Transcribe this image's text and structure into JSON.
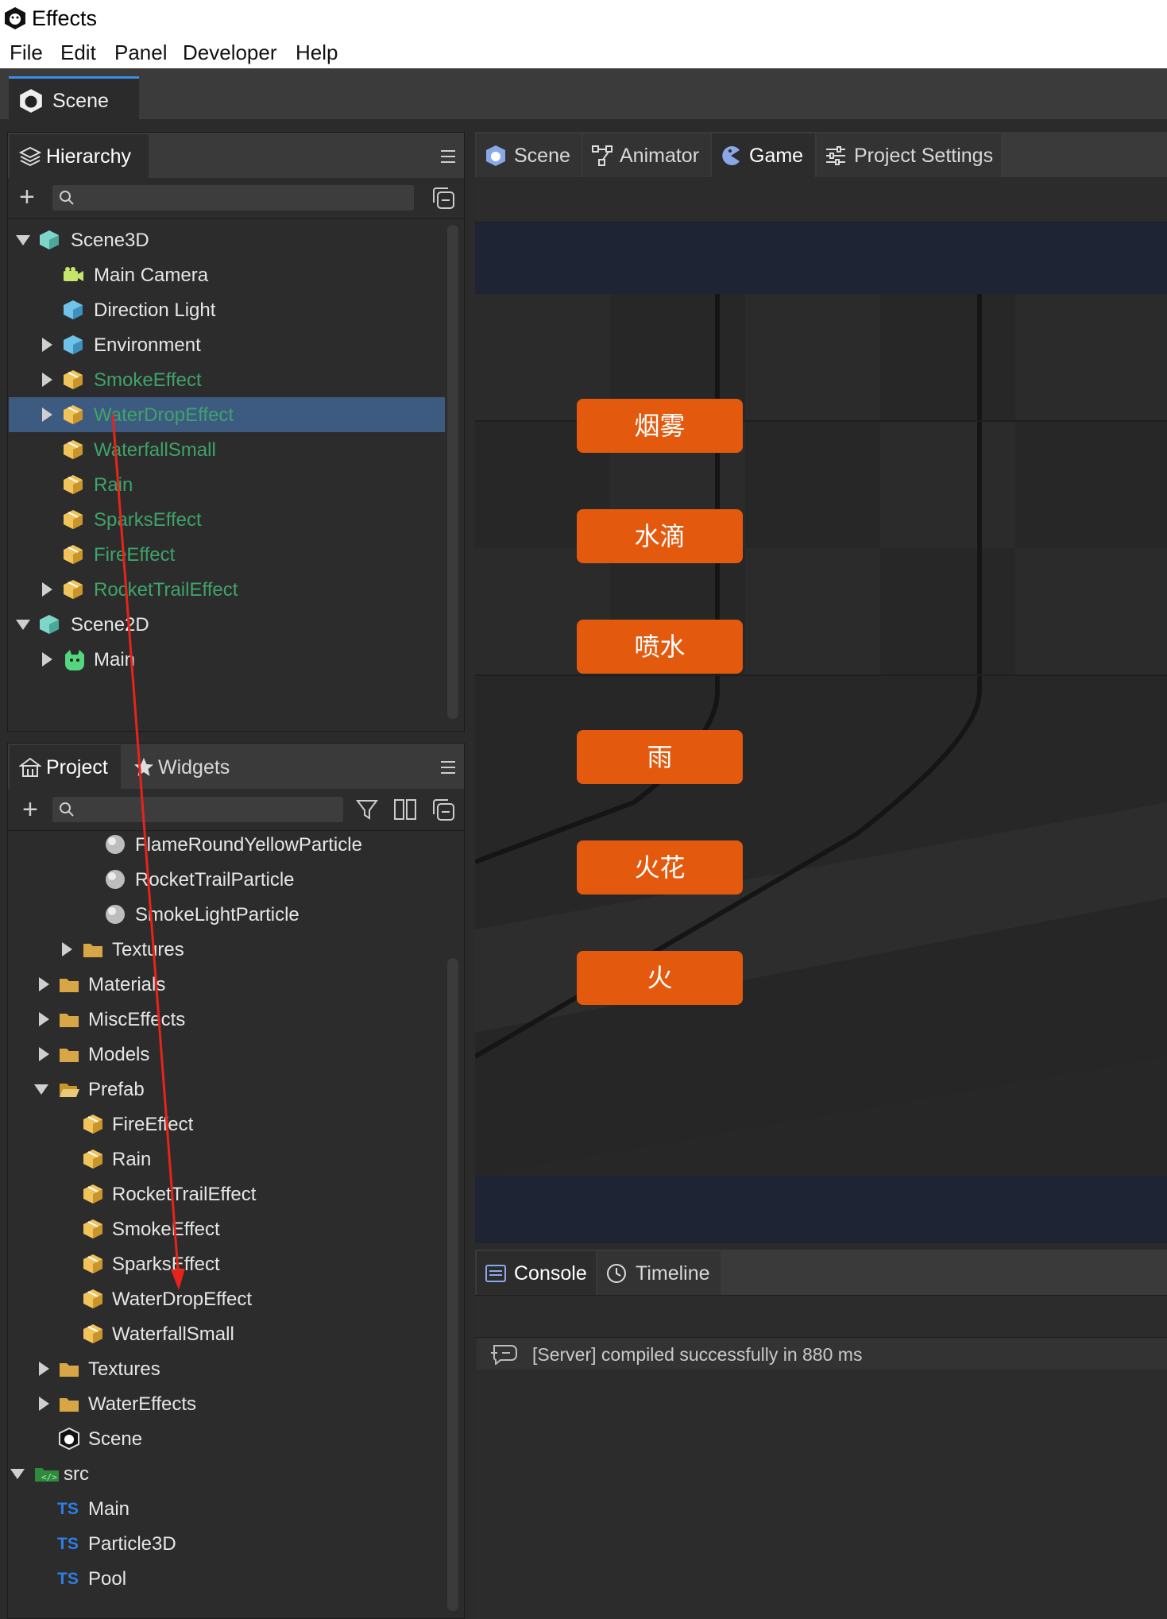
{
  "window": {
    "title": "Effects"
  },
  "menu": [
    "File",
    "Edit",
    "Panel",
    "Developer",
    "Help"
  ],
  "doc_tab": {
    "label": "Scene"
  },
  "hierarchy": {
    "tab_label": "Hierarchy",
    "rows": [
      {
        "label": "Scene3D",
        "color": "#e6e6e6"
      },
      {
        "label": "Main Camera",
        "color": "#e6e6e6"
      },
      {
        "label": "Direction Light",
        "color": "#e6e6e6"
      },
      {
        "label": "Environment",
        "color": "#e6e6e6"
      },
      {
        "label": "SmokeEffect",
        "color": "#3fa36a"
      },
      {
        "label": "WaterDropEffect",
        "color": "#3fa36a"
      },
      {
        "label": "WaterfallSmall",
        "color": "#3fa36a"
      },
      {
        "label": "Rain",
        "color": "#3fa36a"
      },
      {
        "label": "SparksEffect",
        "color": "#3fa36a"
      },
      {
        "label": "FireEffect",
        "color": "#3fa36a"
      },
      {
        "label": "RocketTrailEffect",
        "color": "#3fa36a"
      },
      {
        "label": "Scene2D",
        "color": "#e6e6e6"
      },
      {
        "label": "Main",
        "color": "#e6e6e6"
      }
    ]
  },
  "project": {
    "tabs": [
      "Project",
      "Widgets"
    ],
    "rows": [
      {
        "label": "FlameRoundYellowParticle"
      },
      {
        "label": "RocketTrailParticle"
      },
      {
        "label": "SmokeLightParticle"
      },
      {
        "label": "Textures"
      },
      {
        "label": "Materials"
      },
      {
        "label": "MiscEffects"
      },
      {
        "label": "Models"
      },
      {
        "label": "Prefab"
      },
      {
        "label": "FireEffect"
      },
      {
        "label": "Rain"
      },
      {
        "label": "RocketTrailEffect"
      },
      {
        "label": "SmokeEffect"
      },
      {
        "label": "SparksEffect"
      },
      {
        "label": "WaterDropEffect"
      },
      {
        "label": "WaterfallSmall"
      },
      {
        "label": "Textures"
      },
      {
        "label": "WaterEffects"
      },
      {
        "label": "Scene"
      },
      {
        "label": "src"
      },
      {
        "label": "Main"
      },
      {
        "label": "Particle3D"
      },
      {
        "label": "Pool"
      }
    ]
  },
  "view_tabs": [
    "Scene",
    "Animator",
    "Game",
    "Project Settings"
  ],
  "game_buttons": [
    "烟雾",
    "水滴",
    "喷水",
    "雨",
    "火花",
    "火"
  ],
  "bottom_tabs": [
    "Console",
    "Timeline"
  ],
  "console": {
    "message": "[Server] compiled successfully in 880 ms"
  },
  "colors": {
    "accent": "#3a8ee6",
    "button": "#e35a0e",
    "selected_row": "#3d5a80",
    "prefab_text": "#3fa36a"
  }
}
